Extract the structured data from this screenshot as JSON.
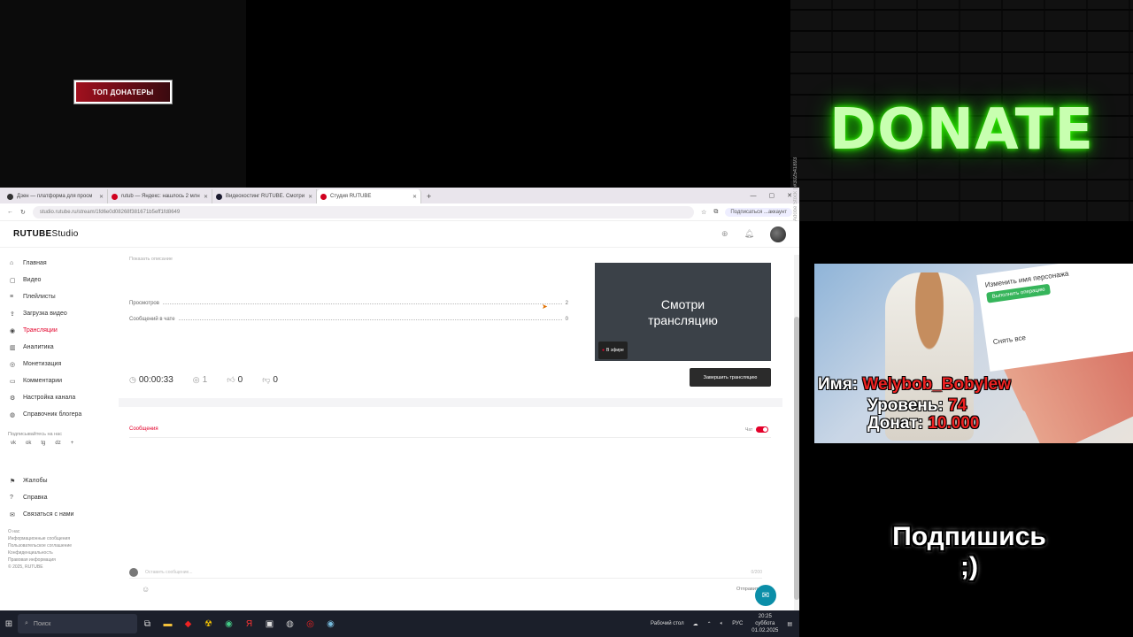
{
  "overlay": {
    "top_donators_label": "ТОП ДОНАТЕРЫ",
    "donate_text": "DONATE",
    "stock_watermark": "Adobe Stock | #302541893",
    "subscribe_text": "Подпишись ;)",
    "promo": {
      "card_text_1": "Изменить имя персонажа",
      "card_button": "Выполнить операцию",
      "card_text_2": "Снять все",
      "name_label": "Имя: ",
      "name_value": "Welybob_Bobylew",
      "level_label": "Уровень: ",
      "level_value": "74",
      "donat_label": "Донат: ",
      "donat_value": "10.000"
    }
  },
  "browser": {
    "tabs": [
      {
        "title": "Дзен — платформа для просм"
      },
      {
        "title": "rutub — Яндекс: нашлось 2 млн"
      },
      {
        "title": "Видеохостинг RUTUBE. Смотри"
      },
      {
        "title": "Студия RUTUBE"
      }
    ],
    "new_tab": "+",
    "url": "studio.rutube.ru/stream/1fd6e0d08268f381671b5eff1fd8649",
    "profile_button": "Подписаться ...аккаунт"
  },
  "app": {
    "logo": "RUTUBE",
    "logo_suffix": "Studio",
    "nav": [
      {
        "label": "Главная",
        "icon": "⌂"
      },
      {
        "label": "Видео",
        "icon": "▢"
      },
      {
        "label": "Плейлисты",
        "icon": "≡"
      },
      {
        "label": "Загрузка видео",
        "icon": "⇪"
      },
      {
        "label": "Трансляции",
        "icon": "◉",
        "active": true
      },
      {
        "label": "Аналитика",
        "icon": "▥"
      },
      {
        "label": "Монетизация",
        "icon": "◎"
      },
      {
        "label": "Комментарии",
        "icon": "▭"
      },
      {
        "label": "Настройка канала",
        "icon": "⚙"
      },
      {
        "label": "Справочник блогера",
        "icon": "◍"
      }
    ],
    "subscribe_section": "Подписывайтесь на нас",
    "social_icons": [
      "vk",
      "ok",
      "tg",
      "dz",
      "+"
    ],
    "bottom_nav": [
      {
        "label": "Жалобы",
        "icon": "⚑"
      },
      {
        "label": "Справка",
        "icon": "?"
      },
      {
        "label": "Связаться с нами",
        "icon": "✉"
      }
    ],
    "footer_links": [
      "О нас",
      "Информационные сообщения",
      "Пользовательское соглашение",
      "Конфиденциальность",
      "Правовая информация",
      "© 2025, RUTUBE"
    ],
    "show_stats": "Показать описание",
    "stats": [
      {
        "label": "Просмотров",
        "value": "2"
      },
      {
        "label": "Сообщений в чате",
        "value": "0"
      }
    ],
    "preview_text": "Смотри трансляцию",
    "live_badge": "В эфире",
    "duration": "00:00:33",
    "viewers": "1",
    "likes": "0",
    "dislikes": "0",
    "end_button": "Завершить трансляцию",
    "messages_tab": "Сообщения",
    "chat_toggle_label": "Чат",
    "message_placeholder": "Оставить сообщение...",
    "message_counter": "0/200",
    "send_label": "Отправить"
  },
  "taskbar": {
    "search_placeholder": "Поиск",
    "desktop_label": "Рабочий стол",
    "lang": "РУС",
    "time": "20:25",
    "day": "суббота",
    "date": "01.02.2025"
  }
}
